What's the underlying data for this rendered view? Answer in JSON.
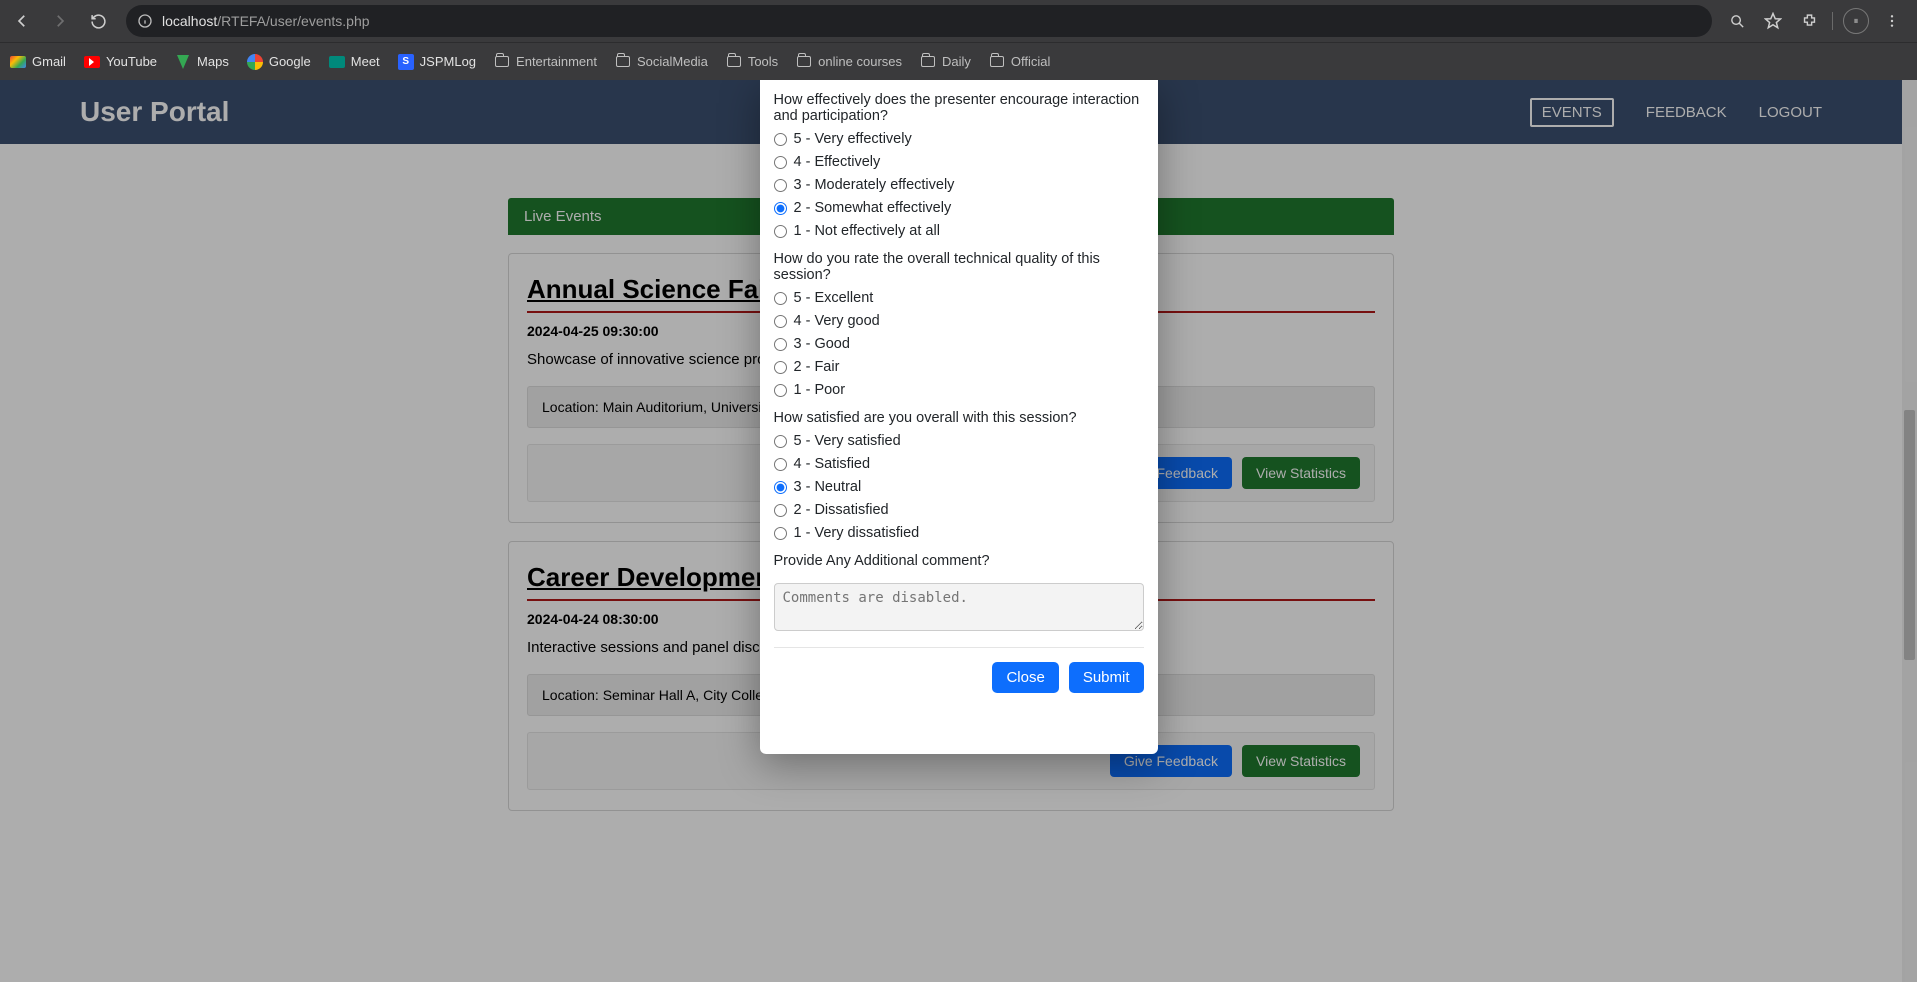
{
  "browser": {
    "url_host": "localhost",
    "url_path": "/RTEFA/user/events.php",
    "bookmarks": [
      {
        "label": "Gmail",
        "icon": "gmail"
      },
      {
        "label": "YouTube",
        "icon": "youtube"
      },
      {
        "label": "Maps",
        "icon": "maps"
      },
      {
        "label": "Google",
        "icon": "google"
      },
      {
        "label": "Meet",
        "icon": "meet"
      },
      {
        "label": "JSPMLog",
        "icon": "jspm"
      },
      {
        "label": "Entertainment",
        "icon": "folder"
      },
      {
        "label": "SocialMedia",
        "icon": "folder"
      },
      {
        "label": "Tools",
        "icon": "folder"
      },
      {
        "label": "online courses",
        "icon": "folder"
      },
      {
        "label": "Daily",
        "icon": "folder"
      },
      {
        "label": "Official",
        "icon": "folder"
      }
    ]
  },
  "nav": {
    "brand": "User Portal",
    "links": {
      "events": "EVENTS",
      "feedback": "FEEDBACK",
      "logout": "LOGOUT"
    }
  },
  "page": {
    "live_label": "Live Events",
    "give_feedback_label": "Give Feedback",
    "view_stats_label": "View Statistics",
    "location_prefix": "Location: ",
    "events": [
      {
        "title": "Annual Science Fair",
        "datetime": "2024-04-25 09:30:00",
        "desc": "Showcase of innovative science projects by students.",
        "location": "Main Auditorium, University Campus"
      },
      {
        "title": "Career Development Workshop",
        "datetime": "2024-04-24 08:30:00",
        "desc": "Interactive sessions and panel discussions on career planning and job search strategies.",
        "location": "Seminar Hall A, City College"
      }
    ]
  },
  "modal": {
    "questions": [
      {
        "text": "How effectively does the presenter encourage interaction and participation?",
        "selected": "2",
        "options": [
          {
            "val": "5",
            "label": "5 - Very effectively"
          },
          {
            "val": "4",
            "label": "4 - Effectively"
          },
          {
            "val": "3",
            "label": "3 - Moderately effectively"
          },
          {
            "val": "2",
            "label": "2 - Somewhat effectively"
          },
          {
            "val": "1",
            "label": "1 - Not effectively at all"
          }
        ]
      },
      {
        "text": "How do you rate the overall technical quality of this session?",
        "selected": null,
        "options": [
          {
            "val": "5",
            "label": "5 - Excellent"
          },
          {
            "val": "4",
            "label": "4 - Very good"
          },
          {
            "val": "3",
            "label": "3 - Good"
          },
          {
            "val": "2",
            "label": "2 - Fair"
          },
          {
            "val": "1",
            "label": "1 - Poor"
          }
        ]
      },
      {
        "text": "How satisfied are you overall with this session?",
        "selected": "3",
        "options": [
          {
            "val": "5",
            "label": "5 - Very satisfied"
          },
          {
            "val": "4",
            "label": "4 - Satisfied"
          },
          {
            "val": "3",
            "label": "3 - Neutral"
          },
          {
            "val": "2",
            "label": "2 - Dissatisfied"
          },
          {
            "val": "1",
            "label": "1 - Very dissatisfied"
          }
        ]
      }
    ],
    "comment_label": "Provide Any Additional comment?",
    "comment_placeholder": "Comments are disabled.",
    "close_label": "Close",
    "submit_label": "Submit"
  }
}
